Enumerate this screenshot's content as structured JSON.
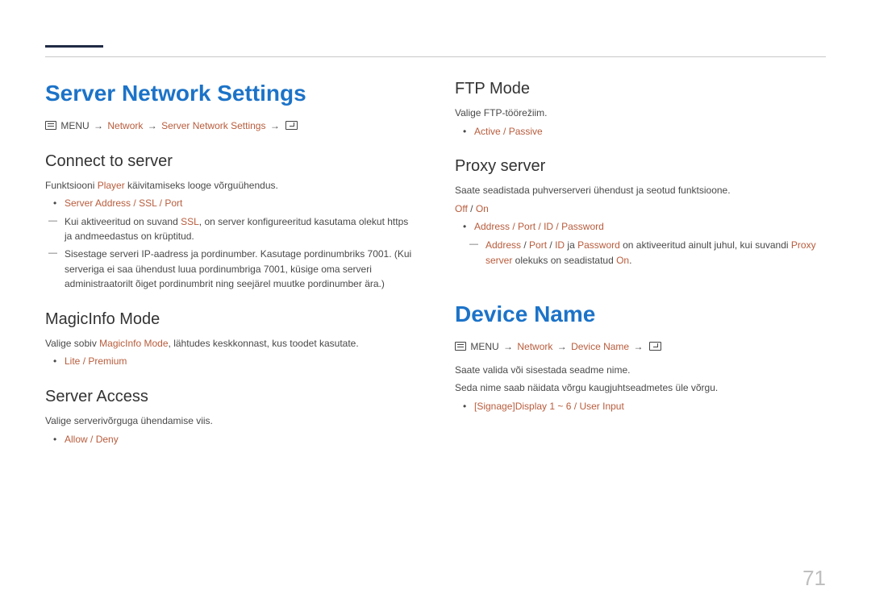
{
  "page_number": "71",
  "left": {
    "h1": "Server Network Settings",
    "crumb": {
      "menu": "MENU",
      "path1": "Network",
      "path2": "Server Network Settings"
    },
    "connect": {
      "heading": "Connect to server",
      "intro_pre": "Funktsiooni ",
      "intro_hl": "Player",
      "intro_post": " käivitamiseks looge võrguühendus.",
      "bullet": {
        "a": "Server Address",
        "sep": " / ",
        "b": "SSL",
        "c": "Port"
      },
      "dash1_pre": "Kui aktiveeritud on suvand ",
      "dash1_hl1": "SSL",
      "dash1_mid": ", on server konfigureeritud kasutama olekut ",
      "dash1_hl2": "https",
      "dash1_post": " ja andmeedastus on krüptitud.",
      "dash2": "Sisestage serveri IP-aadress ja pordinumber. Kasutage pordinumbriks 7001. (Kui serveriga ei saa ühendust luua pordinumbriga 7001, küsige oma serveri administraatorilt õiget pordinumbrit ning seejärel muutke pordinumber ära.)"
    },
    "magic": {
      "heading": "MagicInfo Mode",
      "intro_pre": "Valige sobiv ",
      "intro_hl": "MagicInfo Mode",
      "intro_post": ", lähtudes keskkonnast, kus toodet kasutate.",
      "bullet": {
        "a": "Lite",
        "sep": " / ",
        "b": "Premium"
      }
    },
    "access": {
      "heading": "Server Access",
      "intro": "Valige serverivõrguga ühendamise viis.",
      "bullet": {
        "a": "Allow",
        "sep": " / ",
        "b": "Deny"
      }
    }
  },
  "right": {
    "ftp": {
      "heading": "FTP Mode",
      "intro": "Valige FTP-töörežiim.",
      "bullet": {
        "a": "Active",
        "sep": " / ",
        "b": "Passive"
      }
    },
    "proxy": {
      "heading": "Proxy server",
      "intro": "Saate seadistada puhverserveri ühendust ja seotud funktsioone.",
      "offon": {
        "a": "Off",
        "sep": " / ",
        "b": "On"
      },
      "bullet": {
        "a": "Address",
        "b": "Port",
        "c": "ID",
        "d": "Password",
        "sep": " / "
      },
      "dash_pre1": "Address",
      "dash_pre2": "Port",
      "dash_pre3": "ID",
      "dash_mid_ja": " ja ",
      "dash_pre4": "Password",
      "dash_mid": " on aktiveeritud ainult juhul, kui suvandi ",
      "dash_hl": "Proxy server",
      "dash_mid2": " olekuks on seadistatud ",
      "dash_on": "On",
      "dash_end": "."
    },
    "device": {
      "h1": "Device Name",
      "crumb": {
        "menu": "MENU",
        "path1": "Network",
        "path2": "Device Name"
      },
      "p1": "Saate valida või sisestada seadme nime.",
      "p2": "Seda nime saab näidata võrgu kaugjuhtseadmetes üle võrgu.",
      "bullet": {
        "a": "[Signage]Display 1",
        "tilde": " ~ ",
        "b": "6",
        "sep": " / ",
        "c": "User Input"
      }
    }
  }
}
